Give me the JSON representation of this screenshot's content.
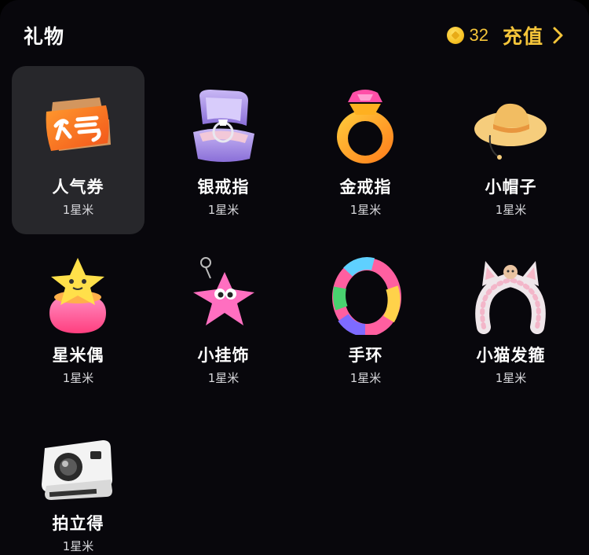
{
  "header": {
    "title": "礼物",
    "balance": "32",
    "recharge_label": "充值"
  },
  "gifts": [
    {
      "name": "人气券",
      "price": "1星米",
      "icon": "popularity-ticket-icon",
      "selected": true
    },
    {
      "name": "银戒指",
      "price": "1星米",
      "icon": "silver-ring-icon"
    },
    {
      "name": "金戒指",
      "price": "1星米",
      "icon": "gold-ring-icon"
    },
    {
      "name": "小帽子",
      "price": "1星米",
      "icon": "small-hat-icon"
    },
    {
      "name": "星米偶",
      "price": "1星米",
      "icon": "star-doll-icon"
    },
    {
      "name": "小挂饰",
      "price": "1星米",
      "icon": "star-charm-icon"
    },
    {
      "name": "手环",
      "price": "1星米",
      "icon": "bracelet-icon"
    },
    {
      "name": "小猫发箍",
      "price": "1星米",
      "icon": "cat-headband-icon"
    },
    {
      "name": "拍立得",
      "price": "1星米",
      "icon": "instant-camera-icon"
    }
  ],
  "colors": {
    "accent": "#f5c53a",
    "background": "#08070c",
    "selected_cell": "#27272b"
  }
}
